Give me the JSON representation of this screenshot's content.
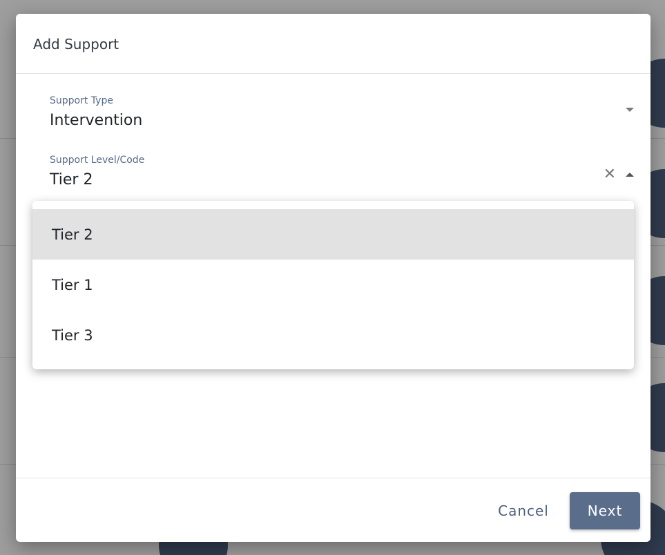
{
  "dialog": {
    "title": "Add Support"
  },
  "fields": {
    "support_type": {
      "label": "Support Type",
      "value": "Intervention"
    },
    "support_level": {
      "label": "Support Level/Code",
      "value": "Tier 2"
    }
  },
  "dropdown": {
    "options": [
      {
        "label": "Tier 2",
        "selected": true
      },
      {
        "label": "Tier 1",
        "selected": false
      },
      {
        "label": "Tier 3",
        "selected": false
      }
    ]
  },
  "footer": {
    "cancel_label": "Cancel",
    "next_label": "Next"
  },
  "icons": {
    "support_type_dropdown": "caret-down-icon",
    "clear": "close-icon",
    "support_level_dropdown": "caret-up-icon"
  },
  "colors": {
    "primary_button": "#5a6e8c",
    "label_text": "#56698a",
    "selected_option_bg": "#e2e2e2",
    "backdrop": "#9e9e9e"
  }
}
